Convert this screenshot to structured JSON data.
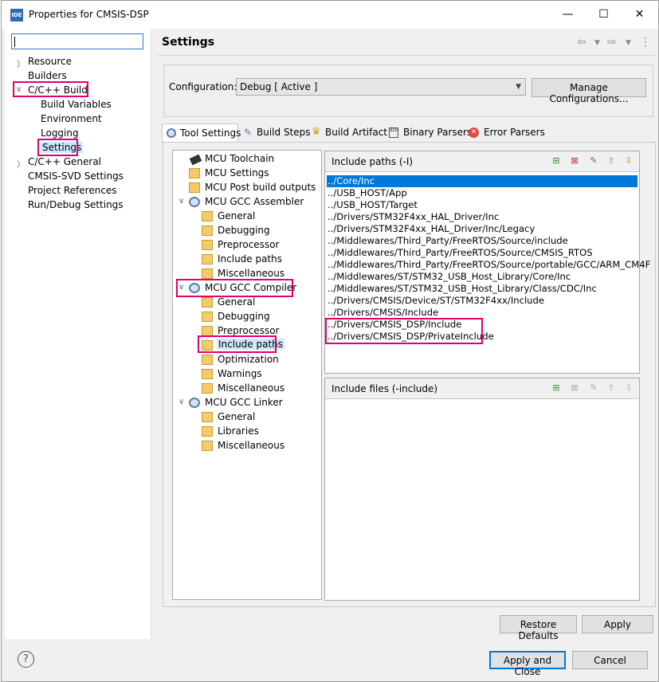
{
  "window": {
    "icon_text": "IDE",
    "title": "Properties for CMSIS-DSP"
  },
  "left_nav": {
    "filter_value": "",
    "items": [
      {
        "label": "Resource"
      },
      {
        "label": "Builders"
      },
      {
        "label": "C/C++ Build"
      },
      {
        "label": "Build Variables"
      },
      {
        "label": "Environment"
      },
      {
        "label": "Logging"
      },
      {
        "label": "Settings"
      },
      {
        "label": "C/C++ General"
      },
      {
        "label": "CMSIS-SVD Settings"
      },
      {
        "label": "Project References"
      },
      {
        "label": "Run/Debug Settings"
      }
    ]
  },
  "page_title": "Settings",
  "config": {
    "label": "Configuration:",
    "value": "Debug  [ Active ]",
    "manage_button": "Manage Configurations..."
  },
  "tabs": [
    "Tool Settings",
    "Build Steps",
    "Build Artifact",
    "Binary Parsers",
    "Error Parsers"
  ],
  "tree": [
    "MCU Toolchain",
    "MCU Settings",
    "MCU Post build outputs",
    "MCU GCC Assembler",
    "General",
    "Debugging",
    "Preprocessor",
    "Include paths",
    "Miscellaneous",
    "MCU GCC Compiler",
    "General",
    "Debugging",
    "Preprocessor",
    "Include paths",
    "Optimization",
    "Warnings",
    "Miscellaneous",
    "MCU GCC Linker",
    "General",
    "Libraries",
    "Miscellaneous"
  ],
  "include_paths": {
    "header": "Include paths (-I)",
    "items": [
      "../Core/Inc",
      "../USB_HOST/App",
      "../USB_HOST/Target",
      "../Drivers/STM32F4xx_HAL_Driver/Inc",
      "../Drivers/STM32F4xx_HAL_Driver/Inc/Legacy",
      "../Middlewares/Third_Party/FreeRTOS/Source/include",
      "../Middlewares/Third_Party/FreeRTOS/Source/CMSIS_RTOS",
      "../Middlewares/Third_Party/FreeRTOS/Source/portable/GCC/ARM_CM4F",
      "../Middlewares/ST/STM32_USB_Host_Library/Core/Inc",
      "../Middlewares/ST/STM32_USB_Host_Library/Class/CDC/Inc",
      "../Drivers/CMSIS/Device/ST/STM32F4xx/Include",
      "../Drivers/CMSIS/Include",
      "../Drivers/CMSIS_DSP/Include",
      "../Drivers/CMSIS_DSP/PrivateInclude"
    ]
  },
  "include_files": {
    "header": "Include files (-include)"
  },
  "buttons": {
    "restore": "Restore Defaults",
    "apply": "Apply",
    "apply_close": "Apply and Close",
    "cancel": "Cancel"
  },
  "icons": {
    "help": "?"
  },
  "colors": {
    "highlight": "#e0006c",
    "selection": "#0078d7"
  }
}
